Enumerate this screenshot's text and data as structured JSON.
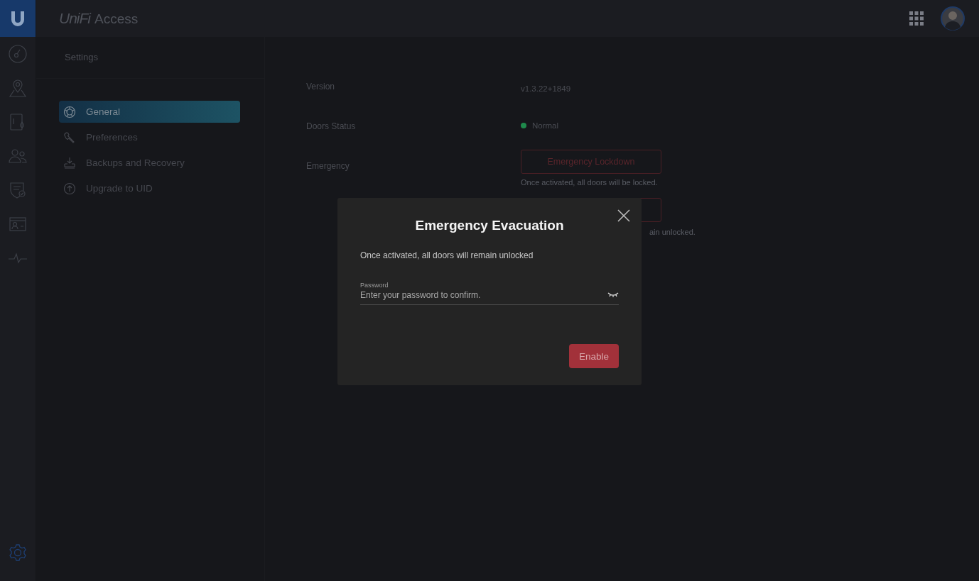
{
  "app": {
    "brand": "UniFi",
    "product": "Access"
  },
  "rail": [
    {
      "kind": "dashboard",
      "selected": false
    },
    {
      "kind": "map",
      "selected": false
    },
    {
      "kind": "door",
      "selected": false
    },
    {
      "kind": "users",
      "selected": false
    },
    {
      "kind": "policy",
      "selected": false
    },
    {
      "kind": "card",
      "selected": false
    },
    {
      "kind": "activity",
      "selected": false
    }
  ],
  "rail_bottom": {
    "kind": "settings",
    "selected": true
  },
  "settings": {
    "title": "Settings",
    "items": [
      {
        "label": "General",
        "kind": "general",
        "selected": true
      },
      {
        "label": "Preferences",
        "kind": "wrench",
        "selected": false
      },
      {
        "label": "Backups and Recovery",
        "kind": "download",
        "selected": false
      },
      {
        "label": "Upgrade to UID",
        "kind": "upgrade",
        "selected": false
      }
    ]
  },
  "details": [
    {
      "label": "Version",
      "kind": "text",
      "value": "v1.3.22+1849"
    },
    {
      "label": "Doors Status",
      "kind": "status",
      "value": "Normal",
      "color": "#1f8a4c"
    },
    {
      "label": "Emergency",
      "kind": "emergency",
      "lockdown_button": "Emergency Lockdown",
      "lockdown_hint": "Once activated, all doors will be locked.",
      "evacuation_hint": "ain unlocked."
    }
  ],
  "dialog": {
    "title": "Emergency Evacuation",
    "message": "Once activated, all doors will remain unlocked",
    "field_label": "Password",
    "placeholder": "Enter your password to confirm.",
    "button": "Enable"
  }
}
